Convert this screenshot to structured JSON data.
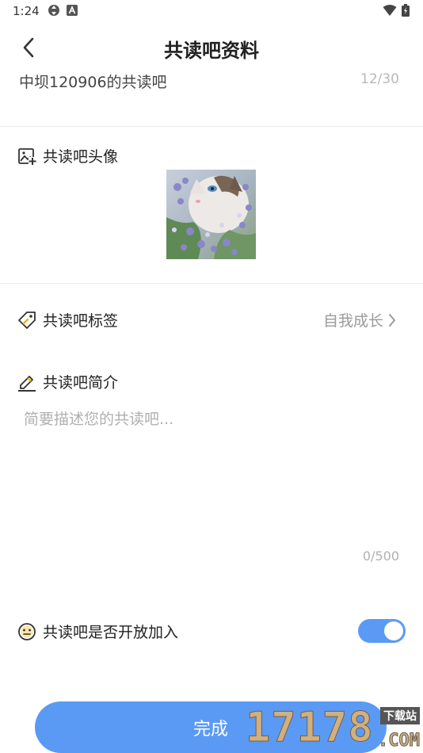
{
  "status_bar": {
    "time": "1:24"
  },
  "header": {
    "title": "共读吧资料"
  },
  "name_row": {
    "value": "中坝120906的共读吧",
    "count": "12/30"
  },
  "avatar_section": {
    "label": "共读吧头像"
  },
  "tag_section": {
    "label": "共读吧标签",
    "value": "自我成长"
  },
  "intro_section": {
    "label": "共读吧简介",
    "placeholder": "简要描述您的共读吧...",
    "count": "0/500"
  },
  "join_section": {
    "label": "共读吧是否开放加入",
    "toggle_on": true
  },
  "footer": {
    "done_label": "完成"
  },
  "watermark": {
    "digits": "17178",
    "sub": "下载站",
    "com": ".COM"
  },
  "colors": {
    "accent": "#5b9af4",
    "watermark": "#d6b27a"
  }
}
